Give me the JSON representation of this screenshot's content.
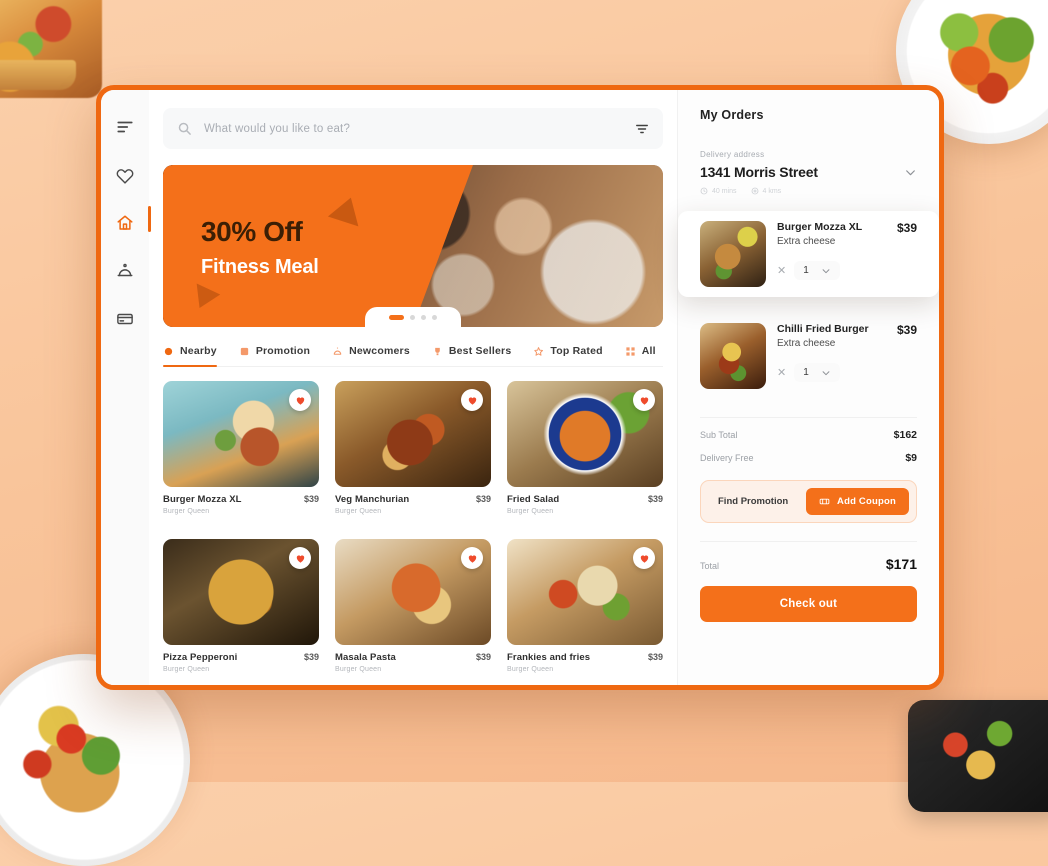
{
  "theme": {
    "accent": "#f4701a",
    "accent_border": "#ef6811",
    "page_bg_from": "#fbd0ab",
    "page_bg_to": "#f6b88c"
  },
  "rail": {
    "items": [
      {
        "name": "menu-icon",
        "label": "Menu",
        "active": false
      },
      {
        "name": "favorites-icon",
        "label": "Favorites",
        "active": false
      },
      {
        "name": "home-icon",
        "label": "Home",
        "active": true
      },
      {
        "name": "room-service-icon",
        "label": "Orders",
        "active": false
      },
      {
        "name": "payment-card-icon",
        "label": "Payment",
        "active": false
      }
    ]
  },
  "search": {
    "placeholder": "What would you like to eat?",
    "value": "",
    "icon": "search-icon",
    "filter_icon": "filter-icon"
  },
  "banner": {
    "headline": "30% Off",
    "subhead": "Fitness Meal",
    "slides": 4,
    "active_slide": 1
  },
  "tabs": [
    {
      "label": "Nearby",
      "icon": "location-pin-icon",
      "active": true
    },
    {
      "label": "Promotion",
      "icon": "tag-icon",
      "active": false
    },
    {
      "label": "Newcomers",
      "icon": "bell-icon",
      "active": false
    },
    {
      "label": "Best Sellers",
      "icon": "trophy-icon",
      "active": false
    },
    {
      "label": "Top Rated",
      "icon": "star-icon",
      "active": false
    },
    {
      "label": "All",
      "icon": "grid-icon",
      "active": false
    }
  ],
  "food_grid": [
    {
      "name": "Burger Mozza XL",
      "price": "$39",
      "restaurant": "Burger Queen",
      "photo": "ph-burger1",
      "favorited": true
    },
    {
      "name": "Veg Manchurian",
      "price": "$39",
      "restaurant": "Burger Queen",
      "photo": "ph-manchurian",
      "favorited": true
    },
    {
      "name": "Fried Salad",
      "price": "$39",
      "restaurant": "Burger Queen",
      "photo": "ph-salad",
      "favorited": true
    },
    {
      "name": "Pizza Pepperoni",
      "price": "$39",
      "restaurant": "Burger Queen",
      "photo": "ph-pizza",
      "favorited": true
    },
    {
      "name": "Masala Pasta",
      "price": "$39",
      "restaurant": "Burger Queen",
      "photo": "ph-pasta",
      "favorited": true
    },
    {
      "name": "Frankies and fries",
      "price": "$39",
      "restaurant": "Burger Queen",
      "photo": "ph-frankie",
      "favorited": true
    }
  ],
  "orders_panel": {
    "title": "My Orders",
    "address": {
      "label": "Delivery address",
      "value": "1341  Morris Street",
      "chevron_icon": "chevron-down-icon",
      "meta": [
        {
          "icon": "clock-icon",
          "text": "40 mins"
        },
        {
          "icon": "distance-icon",
          "text": "4 kms"
        }
      ]
    },
    "items": [
      {
        "name": "Burger Mozza XL",
        "option": "Extra cheese",
        "price": "$39",
        "qty": "1",
        "thumb": "th-mozza",
        "elevated": true
      },
      {
        "name": "Chilli Fried Burger",
        "option": "Extra cheese",
        "price": "$39",
        "qty": "1",
        "thumb": "th-chilli",
        "elevated": false
      }
    ],
    "summary": [
      {
        "label": "Sub Total",
        "value": "$162"
      },
      {
        "label": "Delivery Free",
        "value": "$9"
      }
    ],
    "promotion": {
      "find_label": "Find Promotion",
      "coupon_label": "Add Coupon",
      "coupon_icon": "ticket-icon"
    },
    "total": {
      "label": "Total",
      "value": "$171"
    },
    "checkout_label": "Check out"
  }
}
